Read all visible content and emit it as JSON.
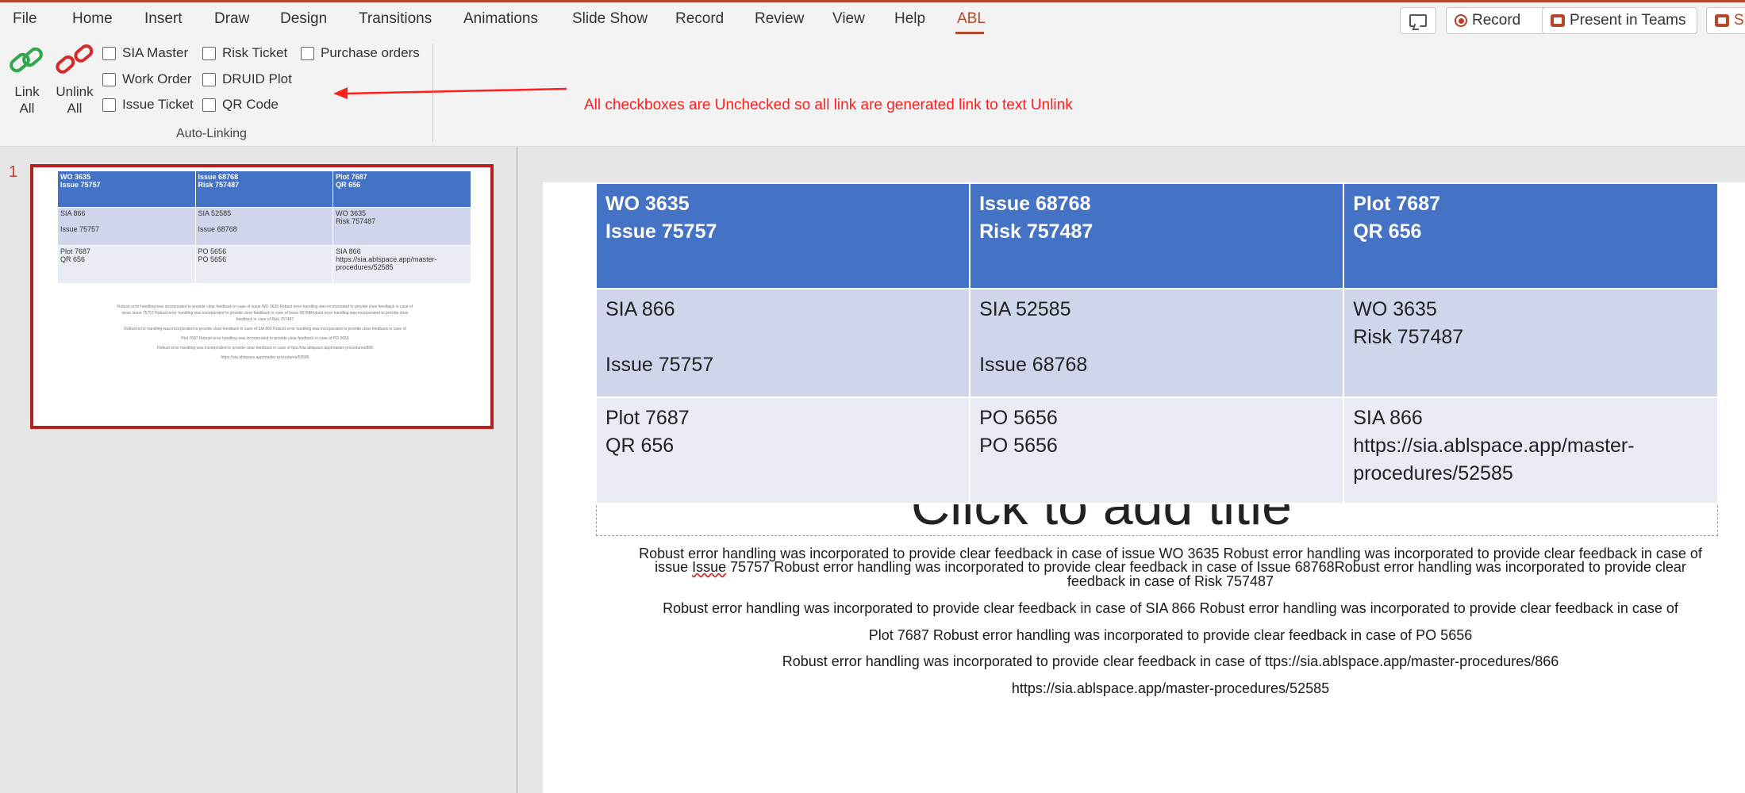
{
  "menu": {
    "tabs": [
      "File",
      "Home",
      "Insert",
      "Draw",
      "Design",
      "Transitions",
      "Animations",
      "Slide Show",
      "Record",
      "Review",
      "View",
      "Help",
      "ABL"
    ],
    "active_tab": "ABL",
    "record_label": "Record",
    "present_teams_label": "Present in Teams",
    "share_partial_label": "Sh"
  },
  "ribbon": {
    "link_all": {
      "line1": "Link",
      "line2": "All"
    },
    "unlink_all": {
      "line1": "Unlink",
      "line2": "All"
    },
    "checkboxes": {
      "sia_master": {
        "label": "SIA Master",
        "checked": false
      },
      "risk_ticket": {
        "label": "Risk Ticket",
        "checked": false
      },
      "purchase_orders": {
        "label": "Purchase orders",
        "checked": false
      },
      "work_order": {
        "label": "Work Order",
        "checked": false
      },
      "druid_plot": {
        "label": "DRUID Plot",
        "checked": false
      },
      "issue_ticket": {
        "label": "Issue Ticket",
        "checked": false
      },
      "qr_code": {
        "label": "QR Code",
        "checked": false
      }
    },
    "group_label": "Auto-Linking"
  },
  "annotation": {
    "text": "All checkboxes are Unchecked so all link are generated link to text Unlink",
    "color": "#ff1f1f"
  },
  "thumbnail": {
    "slide_number": "1",
    "lines": [
      "Robust error handling was incorporated to provide clear feedback in case of issue WO 3635 Robust error handling was incorporated to provide clear feedback in case of",
      "issue Issue 75757 Robust error handling was incorporated to provide clear feedback in case of Issue 68768Robust error handling was incorporated to provide clear",
      "feedback in case of Risk 757487",
      "Robust error handling was incorporated to provide clear feedback in case of SIA 866 Robust error handling was incorporated to provide clear feedback in case of",
      "Plot 7687 Robust error handling was incorporated to provide clear feedback in case of PO 5656",
      "Robust error handling was incorporated to provide clear feedback in case of ttps://sia.ablspace.app/master-procedures/866",
      "https://sia.ablspace.app/master-procedures/52585"
    ]
  },
  "slide_table": {
    "header": [
      {
        "l1": "WO 3635",
        "l2": "Issue 75757"
      },
      {
        "l1": "Issue 68768",
        "l2": "Risk 757487"
      },
      {
        "l1": "Plot 7687",
        "l2": "QR 656"
      }
    ],
    "row1": [
      {
        "l1": "SIA 866",
        "l2": "",
        "l3": "Issue 75757"
      },
      {
        "l1": "SIA 52585",
        "l2": "",
        "l3": "Issue 68768"
      },
      {
        "l1": "WO 3635",
        "l2": "Risk 757487",
        "l3": ""
      }
    ],
    "row2": [
      {
        "l1": "Plot 7687",
        "l2": "QR 656",
        "l3": ""
      },
      {
        "l1": "PO 5656",
        "l2": "PO 5656",
        "l3": ""
      },
      {
        "l1": "SIA 866",
        "l2": "https://sia.ablspace.app/master-",
        "l3": "procedures/52585"
      }
    ]
  },
  "title_placeholder": "Click to add title",
  "body_text": {
    "p1_l1": "Robust error handling was incorporated to provide clear feedback in case of issue  WO 3635 Robust error handling was incorporated to provide clear feedback in case of",
    "p1_l2a": "issue ",
    "p1_l2_issue": "Issue",
    "p1_l2b": " 75757 Robust error handling was incorporated to provide clear feedback in case of Issue 68768Robust error handling was incorporated to provide clear",
    "p1_l3": "feedback in case of Risk 757487",
    "p2_l1": "Robust error handling was incorporated to provide clear feedback in case of SIA 866 Robust error handling was incorporated to provide clear feedback in case of",
    "p2_l2": "Plot 7687 Robust error handling was incorporated to provide clear feedback in case of PO 5656",
    "p3_l1": "Robust error handling was incorporated to provide clear feedback in case of ttps://sia.ablspace.app/master-procedures/866",
    "p3_l2": "https://sia.ablspace.app/master-procedures/52585"
  },
  "colors": {
    "accent": "#b7472a",
    "table_header": "#4472c4",
    "table_row_dark": "#cfd5ea",
    "table_row_light": "#e9ebf5",
    "link_icon_green": "#2ea84a",
    "unlink_icon_red": "#d42b2b"
  },
  "icons": {
    "link_all": "link-icon",
    "unlink_all": "broken-link-icon",
    "comments": "comment-icon",
    "record": "record-icon",
    "present_teams": "teams-icon"
  }
}
